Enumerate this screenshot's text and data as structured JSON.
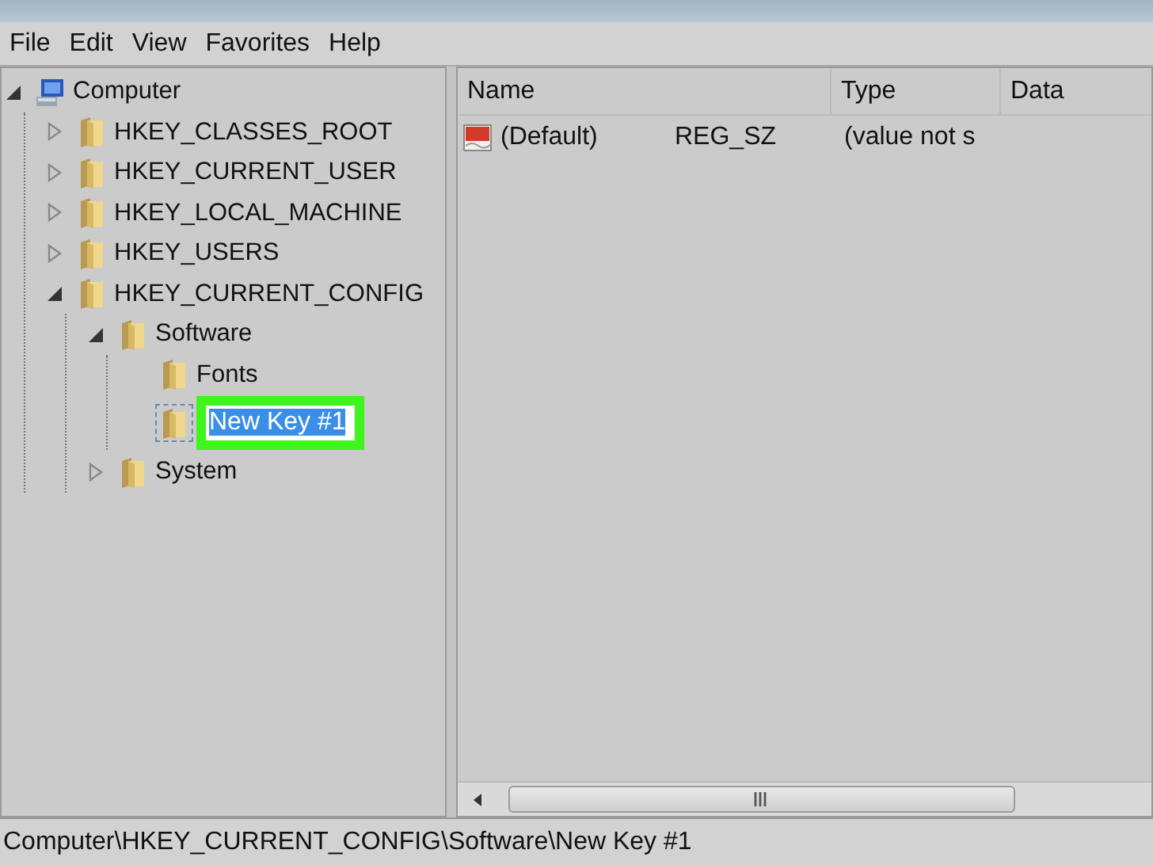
{
  "menu": [
    "File",
    "Edit",
    "View",
    "Favorites",
    "Help"
  ],
  "tree": [
    {
      "label": "Computer",
      "kind": "computer",
      "expanded": true,
      "children": [
        {
          "label": "HKEY_CLASSES_ROOT",
          "kind": "folder",
          "expanded": false
        },
        {
          "label": "HKEY_CURRENT_USER",
          "kind": "folder",
          "expanded": false
        },
        {
          "label": "HKEY_LOCAL_MACHINE",
          "kind": "folder",
          "expanded": false
        },
        {
          "label": "HKEY_USERS",
          "kind": "folder",
          "expanded": false
        },
        {
          "label": "HKEY_CURRENT_CONFIG",
          "kind": "folder",
          "expanded": true,
          "children": [
            {
              "label": "Software",
              "kind": "folder",
              "expanded": true,
              "children": [
                {
                  "label": "Fonts",
                  "kind": "folder"
                },
                {
                  "label": "New Key #1",
                  "kind": "editing",
                  "text_selected": true,
                  "highlighted": true
                }
              ]
            },
            {
              "label": "System",
              "kind": "folder",
              "expanded": false
            }
          ]
        }
      ]
    }
  ],
  "table": {
    "columns": [
      "Name",
      "Type",
      "Data"
    ],
    "rows": [
      {
        "name": "(Default)",
        "type": "REG_SZ",
        "data": "(value not s"
      }
    ]
  },
  "status_bar": "Computer\\HKEY_CURRENT_CONFIG\\Software\\New Key #1"
}
